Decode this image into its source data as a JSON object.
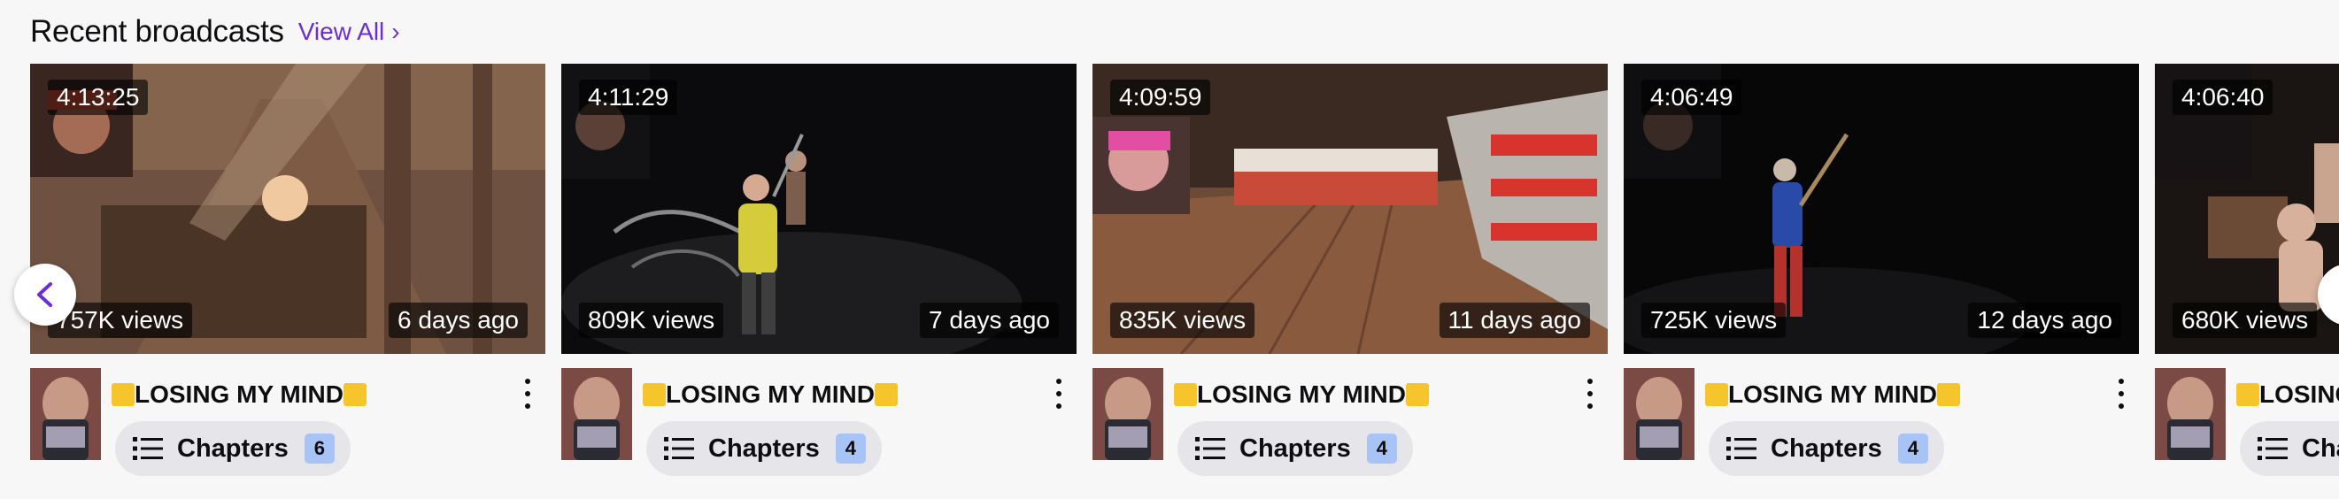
{
  "section": {
    "title": "Recent broadcasts",
    "view_all_label": "View All",
    "view_all_chevron": "›"
  },
  "colors": {
    "accent": "#6b2ed6",
    "title_emoji": "#f6c52b",
    "chapter_badge": "#a8c4f6"
  },
  "icons": {
    "prev": "chevron-left-icon",
    "next": "chevron-right-icon",
    "more": "more-vertical-icon",
    "chapters": "list-icon"
  },
  "broadcasts": [
    {
      "duration": "4:13:25",
      "views": "757K views",
      "age": "6 days ago",
      "title": "LOSING MY MIND",
      "chapters_label": "Chapters",
      "chapters_count": "6"
    },
    {
      "duration": "4:11:29",
      "views": "809K views",
      "age": "7 days ago",
      "title": "LOSING MY MIND",
      "chapters_label": "Chapters",
      "chapters_count": "4"
    },
    {
      "duration": "4:09:59",
      "views": "835K views",
      "age": "11 days ago",
      "title": "LOSING MY MIND",
      "chapters_label": "Chapters",
      "chapters_count": "4"
    },
    {
      "duration": "4:06:49",
      "views": "725K views",
      "age": "12 days ago",
      "title": "LOSING MY MIND",
      "chapters_label": "Chapters",
      "chapters_count": "4"
    },
    {
      "duration": "4:06:40",
      "views": "680K views",
      "age": "",
      "title": "LOSING MY MIND",
      "chapters_label": "Chapters",
      "chapters_count": ""
    }
  ]
}
